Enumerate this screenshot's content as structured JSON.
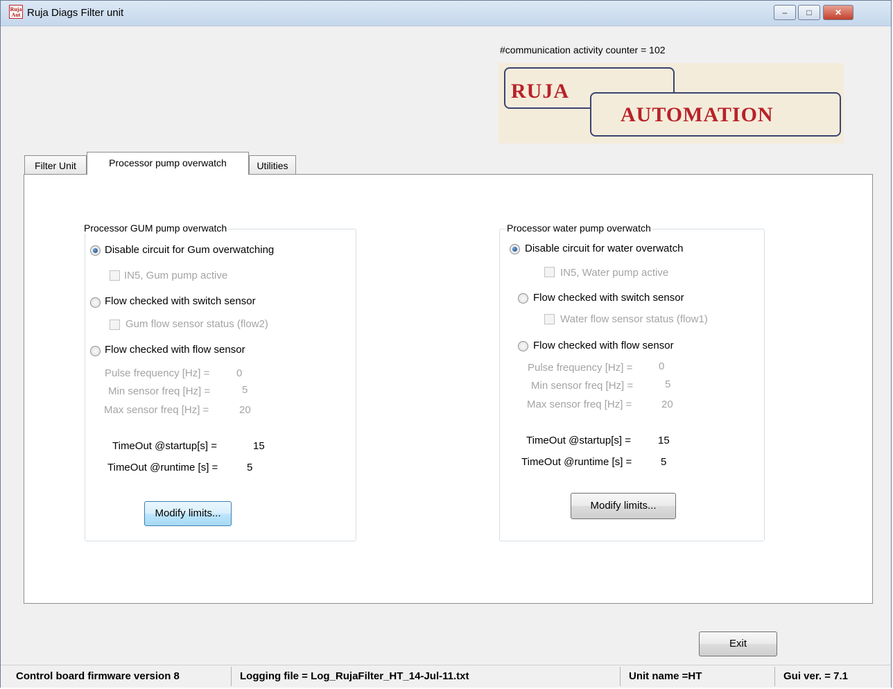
{
  "window": {
    "title": "Ruja Diags Filter unit",
    "icon_label": "Ruja Aut",
    "controls": {
      "minimize": "–",
      "maximize": "□",
      "close": "✕"
    }
  },
  "header": {
    "counter_label": "#communication activity counter = ",
    "counter_value": "102",
    "logo": {
      "line1": "RUJA",
      "line2": "AUTOMATION"
    }
  },
  "tabs": [
    {
      "label": "Filter Unit"
    },
    {
      "label": "Processor pump overwatch"
    },
    {
      "label": "Utilities"
    }
  ],
  "gum": {
    "title": "Processor GUM pump overwatch",
    "radio_disable": "Disable circuit for Gum overwatching",
    "check_pump": "IN5, Gum pump active",
    "radio_switch": "Flow checked with switch sensor",
    "check_flow": "Gum flow sensor status (flow2)",
    "radio_flow": "Flow checked with flow sensor",
    "pulse_label": "Pulse frequency [Hz] =",
    "pulse_value": "0",
    "min_label": "Min sensor freq [Hz] =",
    "min_value": "5",
    "max_label": "Max sensor freq [Hz] =",
    "max_value": "20",
    "startup_label": "TimeOut @startup[s] =",
    "startup_value": "15",
    "runtime_label": "TimeOut @runtime [s] =",
    "runtime_value": "5",
    "modify_button": "Modify limits..."
  },
  "water": {
    "title": "Processor water pump overwatch",
    "radio_disable": "Disable circuit for water overwatch",
    "check_pump": "IN5, Water pump active",
    "radio_switch": "Flow checked with switch sensor",
    "check_flow": "Water flow sensor status (flow1)",
    "radio_flow": "Flow checked with flow sensor",
    "pulse_label": "Pulse frequency [Hz] =",
    "pulse_value": "0",
    "min_label": "Min sensor freq [Hz] =",
    "min_value": "5",
    "max_label": "Max sensor freq [Hz] =",
    "max_value": "20",
    "startup_label": "TimeOut @startup[s] =",
    "startup_value": "15",
    "runtime_label": "TimeOut @runtime [s] =",
    "runtime_value": "5",
    "modify_button": "Modify limits..."
  },
  "exit_button": "Exit",
  "status": {
    "firmware": "Control board firmware version  8",
    "logging": "Logging file = Log_RujaFilter_HT_14-Jul-11.txt",
    "unit": "Unit name =HT",
    "gui": "Gui ver. = 7.1"
  }
}
